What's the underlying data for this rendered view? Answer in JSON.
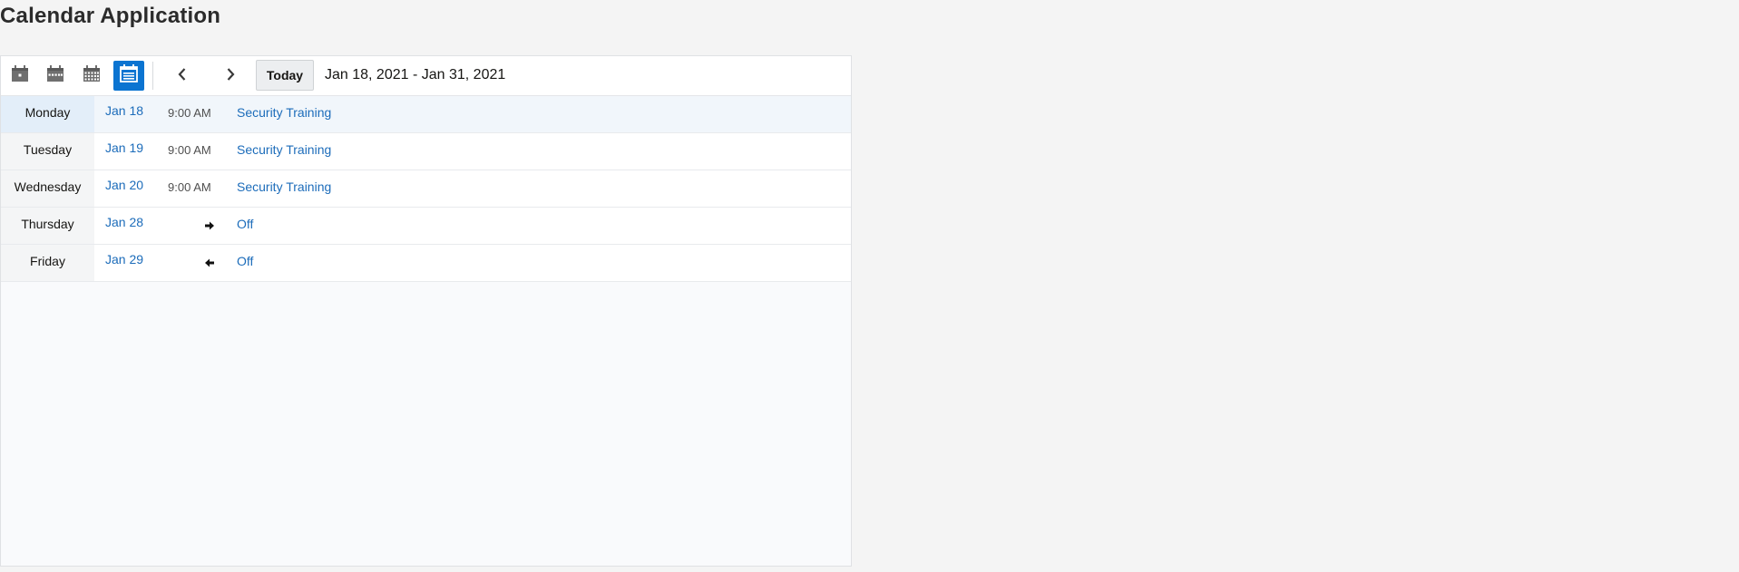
{
  "app": {
    "title": "Calendar Application"
  },
  "toolbar": {
    "views": [
      {
        "name": "day-view-icon",
        "active": false
      },
      {
        "name": "week-view-icon",
        "active": false
      },
      {
        "name": "month-view-icon",
        "active": false
      },
      {
        "name": "list-view-icon",
        "active": true
      }
    ],
    "prev_icon": "chevron-left-icon",
    "next_icon": "chevron-right-icon",
    "today_label": "Today",
    "date_range": "Jan 18, 2021 - Jan 31, 2021"
  },
  "agenda": {
    "rows": [
      {
        "day": "Monday",
        "date": "Jan 18",
        "time": "9:00 AM",
        "event": "Security Training",
        "today": true
      },
      {
        "day": "Tuesday",
        "date": "Jan 19",
        "time": "9:00 AM",
        "event": "Security Training"
      },
      {
        "day": "Wednesday",
        "date": "Jan 20",
        "time": "9:00 AM",
        "event": "Security Training"
      },
      {
        "day": "Thursday",
        "date": "Jan 28",
        "time": "",
        "icon": "arrow-right-icon",
        "event": "Off"
      },
      {
        "day": "Friday",
        "date": "Jan 29",
        "time": "",
        "icon": "arrow-left-icon",
        "event": "Off"
      }
    ]
  },
  "colors": {
    "accent": "#0b74d1",
    "link": "#1c6cba",
    "page_bg": "#f4f4f4"
  }
}
